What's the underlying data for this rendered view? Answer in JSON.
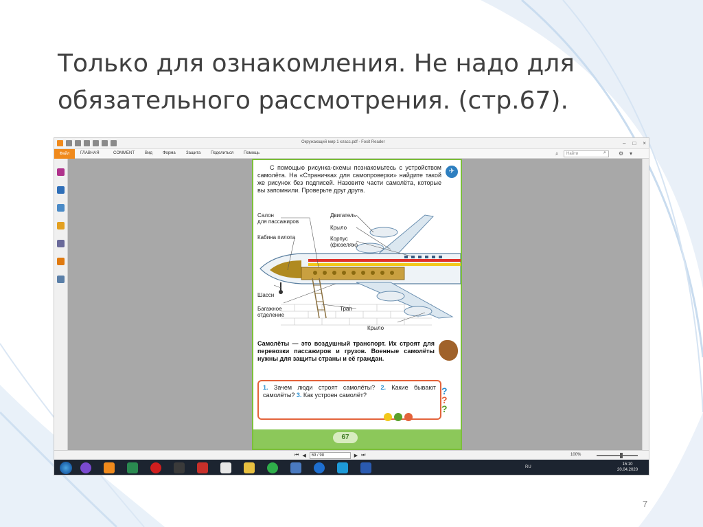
{
  "slide": {
    "title_line1": "Только для ознакомления. Не надо для",
    "title_line2": "обязательного рассмотрения. (стр.67).",
    "number": "7"
  },
  "app": {
    "window_title": "Окружающий мир 1 класс.pdf - Foxit Reader",
    "ribbon_tabs": [
      "Файл",
      "ГЛАВНАЯ",
      "COMMENT",
      "Вид",
      "Форма",
      "Защита",
      "Поделиться",
      "Помощь"
    ],
    "search_placeholder": "Найти",
    "brand_color": "#f08a1c"
  },
  "page": {
    "intro": "С помощью рисунка-схемы познакомьтесь с устройством самолёта. На «Страничках для самопроверки» найдите такой же рисунок без подписей. Назовите части самолёта, которые вы запомнили. Проверьте друг друга.",
    "labels": {
      "salon": "Салон",
      "salon2": "для пассажиров",
      "cabin": "Кабина пилота",
      "engine": "Двигатель",
      "wing_top": "Крыло",
      "body": "Корпус",
      "body2": "(фюзеляж)",
      "chassis": "Шасси",
      "cargo": "Багажное",
      "cargo2": "отделение",
      "ladder": "Трап",
      "wing_bottom": "Крыло"
    },
    "text": "Самолёты — это воздушный транспорт. Их строят для перевозки пассажиров и грузов. Военные самолёты нужны для защиты страны и её граждан.",
    "questions": [
      {
        "num": "1.",
        "text": " Зачем люди строят самолёты? "
      },
      {
        "num": "2.",
        "text": " Какие бывают самолёты? "
      },
      {
        "num": "3.",
        "text": " Как устроен самолёт?"
      }
    ],
    "page_number": "67"
  },
  "status": {
    "page_field": "69 / 98",
    "zoom": "100%",
    "zoom_fraction": 0.6
  },
  "taskbar": {
    "lang": "RU",
    "time": "15:10",
    "date": "20.04.2020"
  }
}
